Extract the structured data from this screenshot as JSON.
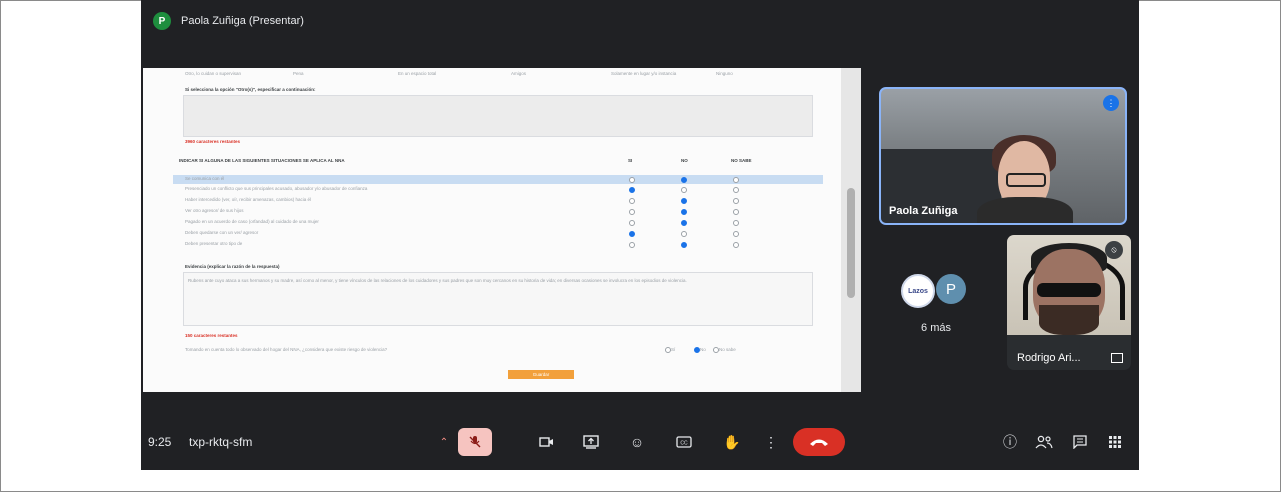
{
  "presenter": {
    "avatar_letter": "P",
    "label": "Paola Zuñiga (Presentar)"
  },
  "document": {
    "top_options": [
      "Otro, lo cuidan o supervisan",
      "Pena",
      "En un espacio total",
      "Amigos",
      "Solamente en lugar y/o instancia",
      "Ninguno"
    ],
    "otro_prompt": "Si selecciona la opción \"Otro(s)\", especificar a continuación:",
    "chars_left_1": "3960 caracteres restantes",
    "situations_title": "INDICAR SI ALGUNA DE LAS SIGUIENTES SITUACIONES SE APLICA AL NNA",
    "col_si": "SI",
    "col_no": "NO",
    "col_nosabe": "NO SABE",
    "situations": [
      {
        "label": "Se comunica con él",
        "selected": "no"
      },
      {
        "label": "Presenciado un conflicto que sus principales acusado, abusador y/o abusador de confianza",
        "selected": "si"
      },
      {
        "label": "Haber intercedido (ver, oír, recibir amenazas, cambios) hacia él",
        "selected": "no"
      },
      {
        "label": "Ver otro agresor/ de sus hijos",
        "selected": "no"
      },
      {
        "label": "Pagado en un acuerdo de caso (orfandad) al cuidado de una mujer",
        "selected": "no"
      },
      {
        "label": "Deben quedarse con un ver/ agresor",
        "selected": "si"
      },
      {
        "label": "Deben presentar otro tipo de",
        "selected": "no"
      }
    ],
    "evidence_title": "Evidencia (explicar la razón de la respuesta)",
    "evidence_text": "Rubens ante cuyo ataca a sus hermanos y su madre, así como al menor, y tiene vínculos de las relaciones de los cuidadores y sus padres que son muy cercanos en su historia de vida; en diversas ocasiones se involucra en los episodios de violencia.",
    "chars_left_2": "150 caracteres restantes",
    "final_question": "Tomando en cuenta todo lo observado del hogar del NNA, ¿considera que existe riesgo de violencia?",
    "final_options": [
      "Sí",
      "No",
      "No sabe"
    ],
    "final_selected": 1,
    "save_label": "Guardar"
  },
  "tiles": {
    "main": {
      "name": "Paola Zuñiga"
    },
    "more_label": "6 más",
    "avatar_logo_text": "Lazos",
    "avatar_letter": "P",
    "second": {
      "name": "Rodrigo Ari..."
    }
  },
  "bottom_bar": {
    "time": "9:25",
    "meeting_code": "txp-rktq-sfm"
  },
  "icons": [
    "mic-off-icon",
    "camera-icon",
    "present-icon",
    "emoji-icon",
    "captions-icon",
    "raise-hand-icon",
    "more-options-icon",
    "end-call-icon",
    "info-icon",
    "people-icon",
    "chat-icon",
    "activities-icon"
  ]
}
